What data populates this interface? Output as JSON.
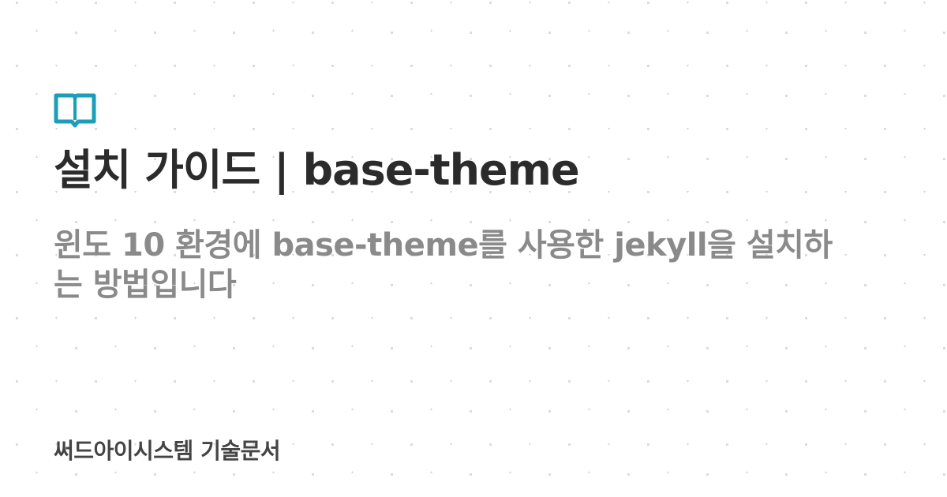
{
  "colors": {
    "background": "#ffffff",
    "pattern_dot": "#d9d9d9",
    "icon_accent": "#1b9fb8",
    "title": "#2b2b2b",
    "description": "#8a8a8a",
    "footer": "#444444"
  },
  "icon": "open-book-icon",
  "title": "설치 가이드 | base-theme",
  "description": "윈도 10 환경에 base-theme를 사용한 jekyll을 설치하는 방법입니다",
  "footer": {
    "site_name": "써드아이시스템 기술문서"
  }
}
